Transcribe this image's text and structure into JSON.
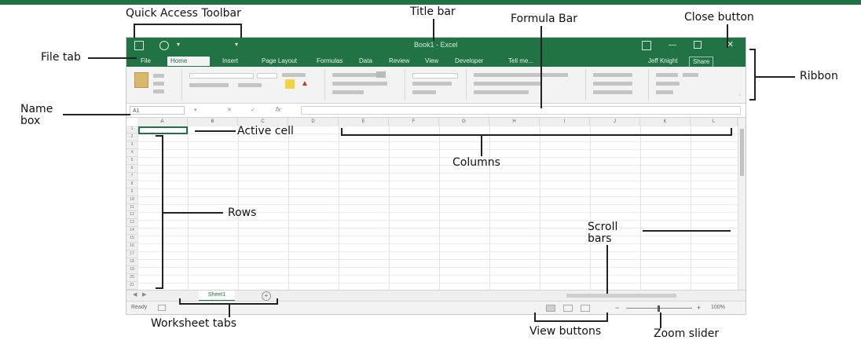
{
  "annotations": {
    "quick_access_toolbar": "Quick Access Toolbar",
    "title_bar": "Title bar",
    "formula_bar": "Formula Bar",
    "close_button": "Close button",
    "file_tab": "File tab",
    "ribbon": "Ribbon",
    "name_box_line1": "Name",
    "name_box_line2": "box",
    "active_cell": "Active cell",
    "columns": "Columns",
    "rows": "Rows",
    "scroll_bars_line1": "Scroll",
    "scroll_bars_line2": "bars",
    "worksheet_tabs": "Worksheet tabs",
    "view_buttons": "View buttons",
    "zoom_slider": "Zoom slider"
  },
  "window": {
    "doc_title": "Book1 - Excel",
    "tabs": [
      "File",
      "Home",
      "Insert",
      "Page Layout",
      "Formulas",
      "Data",
      "Review",
      "View",
      "Developer",
      "Tell me...",
      "Jeff Knight",
      "Share"
    ]
  },
  "sheet": {
    "columns": [
      "A",
      "B",
      "C",
      "D",
      "E",
      "F",
      "G",
      "H",
      "I",
      "J",
      "K",
      "L"
    ],
    "rows": [
      "1",
      "2",
      "3",
      "4",
      "5",
      "6",
      "7",
      "8",
      "9",
      "10",
      "11",
      "12",
      "13",
      "14",
      "15",
      "16",
      "17",
      "18",
      "19",
      "20",
      "21"
    ],
    "tab_name": "Sheet1",
    "add_sheet": "+"
  },
  "status": {
    "ready": "Ready",
    "zoom": "100%"
  },
  "colors": {
    "excel_green": "#217346",
    "ribbon_bg": "#f3f3f3"
  }
}
